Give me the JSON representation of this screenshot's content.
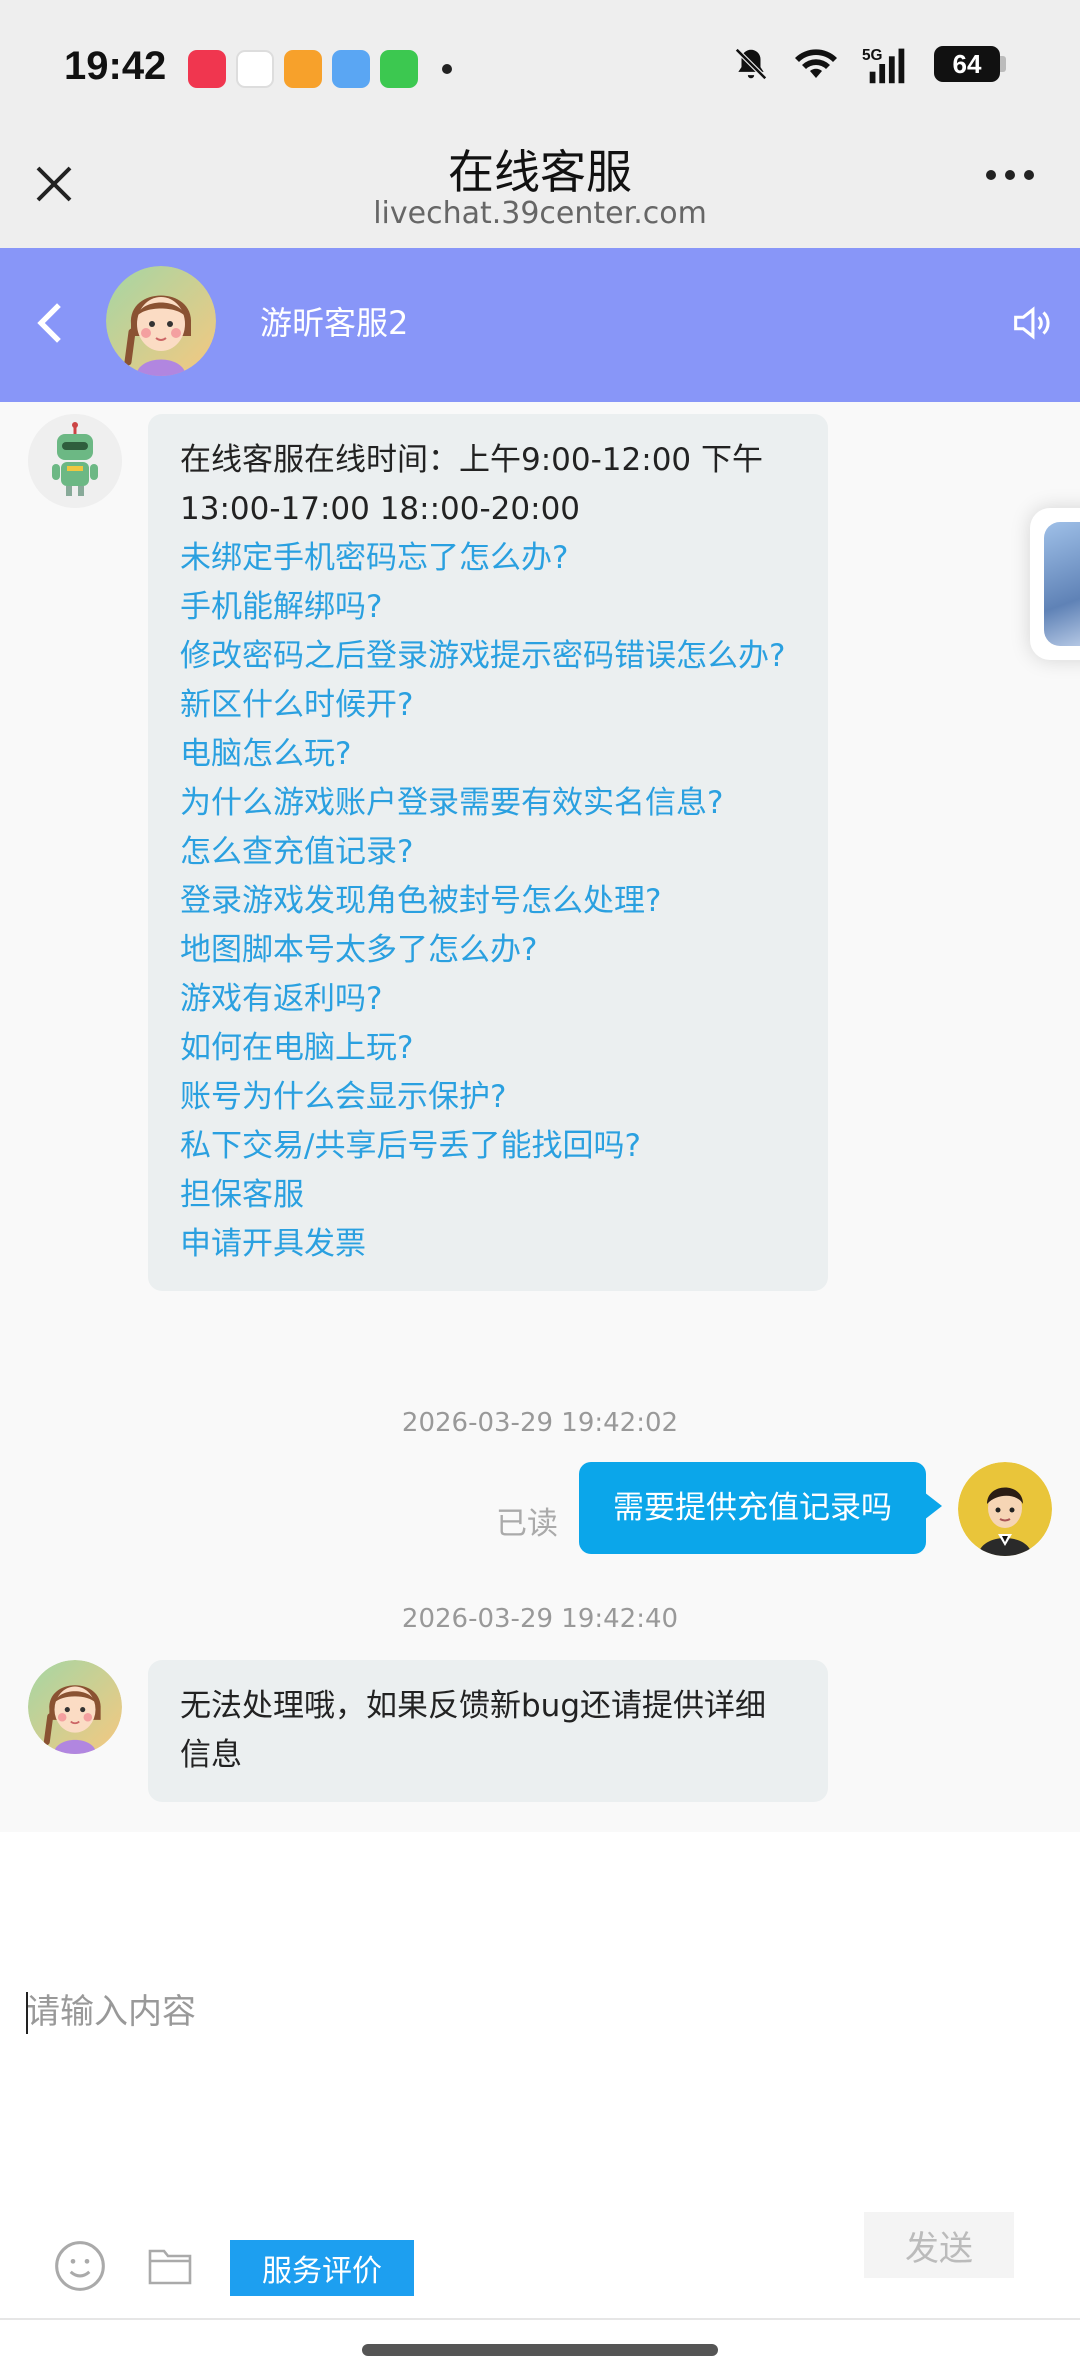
{
  "status_bar": {
    "time": "19:42",
    "battery": "64",
    "network": "5G"
  },
  "browser": {
    "title": "在线客服",
    "url": "livechat.39center.com"
  },
  "chat_header": {
    "agent_name": "游昕客服2",
    "color": "#8896f8"
  },
  "messages": {
    "welcome": {
      "text": "在线客服在线时间：上午9:00-12:00 下午13:00-17:00 18::00-20:00",
      "faq": [
        "未绑定手机密码忘了怎么办?",
        "手机能解绑吗?",
        "修改密码之后登录游戏提示密码错误怎么办?",
        "新区什么时候开?",
        "电脑怎么玩?",
        "为什么游戏账户登录需要有效实名信息?",
        "怎么查充值记录?",
        "登录游戏发现角色被封号怎么处理?",
        "地图脚本号太多了怎么办?",
        "游戏有返利吗?",
        "如何在电脑上玩?",
        "账号为什么会显示保护?",
        "私下交易/共享后号丢了能找回吗?",
        "担保客服",
        "申请开具发票"
      ]
    },
    "timestamp_1": "2026-03-29 19:42:02",
    "user_message": "需要提供充值记录吗",
    "read_status": "已读",
    "timestamp_2": "2026-03-29 19:42:40",
    "agent_reply": "无法处理哦，如果反馈新bug还请提供详细信息"
  },
  "input": {
    "placeholder": "请输入内容",
    "send_label": "发送",
    "rate_label": "服务评价"
  },
  "colors": {
    "link": "#2aa0e0",
    "user_bubble": "#0ba6ea",
    "rate_button": "#1d9ff0"
  }
}
